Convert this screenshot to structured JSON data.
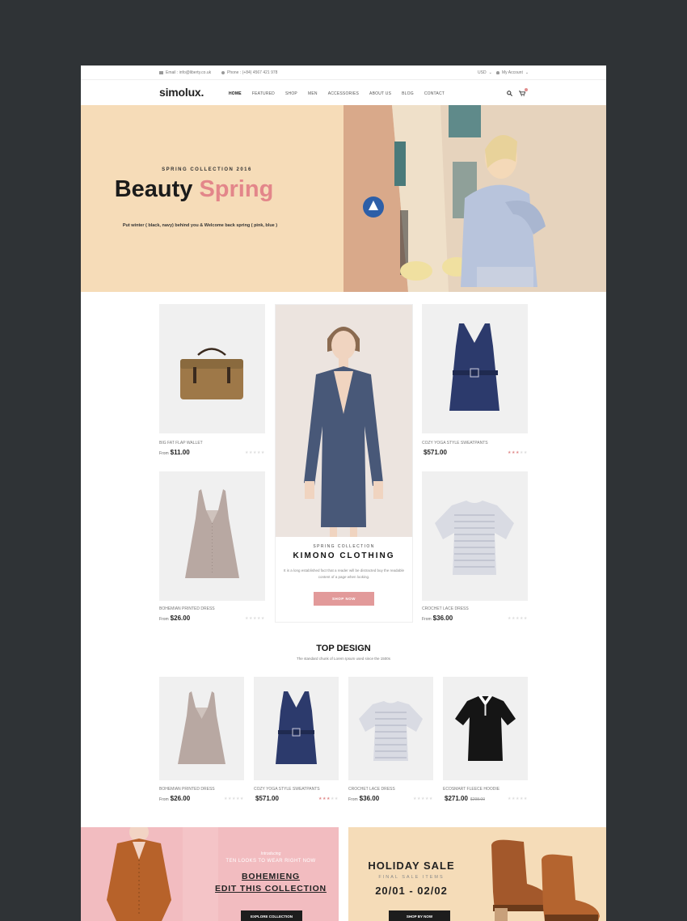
{
  "topbar": {
    "email": "Email : info@liberty.co.uk",
    "phone": "Phone : (+84) 4567 421 978",
    "currency": "USD",
    "currency_caret": "⌄",
    "account": "My Account",
    "account_caret": "⌄"
  },
  "header": {
    "logo": "simolux.",
    "nav": [
      "HOME",
      "FEATURED",
      "SHOP",
      "MEN",
      "ACCESSORIES",
      "ABOUT US",
      "BLOG",
      "CONTACT"
    ],
    "active_nav": "HOME",
    "search_icon": "⚲",
    "cart_icon": "🛒"
  },
  "hero": {
    "subtitle": "SPRING COLLECTION 2016",
    "title_main": "Beauty",
    "title_accent": "Spring",
    "description": "Put winter ( black, navy) behind you & Welcome back spring ( pink, blue )"
  },
  "grid_products": [
    {
      "name": "BIG FAT FLAP WALLET",
      "from": "From",
      "price": "$11.00",
      "rating": 0
    },
    {
      "name": "COZY YOGA STYLE SWEATPANTS",
      "from": "",
      "price": "$571.00",
      "rating": 3
    },
    {
      "name": "BOHEMIAN PRINTED DRESS",
      "from": "From",
      "price": "$26.00",
      "rating": 0
    },
    {
      "name": "CROCHET LACE DRESS",
      "from": "From",
      "price": "$36.00",
      "rating": 0
    }
  ],
  "feature": {
    "subtitle": "SPRING COLLECTION",
    "title": "KIMONO CLOTHING",
    "description": "It is a long established fact that a reader will be distracted buy the readable content of a page when looking.",
    "button": "SHOP NOW"
  },
  "top_design": {
    "title": "TOP DESIGN",
    "subtitle": "The standard chunk of Lorem Ipsum used since the 1500s",
    "products": [
      {
        "name": "BOHEMIAN PRINTED DRESS",
        "from": "From",
        "price": "$26.00",
        "old_price": "",
        "rating": 0
      },
      {
        "name": "COZY YOGA STYLE SWEATPANTS",
        "from": "",
        "price": "$571.00",
        "old_price": "",
        "rating": 3
      },
      {
        "name": "CROCHET LACE DRESS",
        "from": "From",
        "price": "$36.00",
        "old_price": "",
        "rating": 0
      },
      {
        "name": "ECOSMART FLEECE HOODIE",
        "from": "",
        "price": "$271.00",
        "old_price": "$298.00",
        "rating": 0
      }
    ]
  },
  "banner_left": {
    "intro": "Introducing",
    "line1": "TEN LOOKS TO WEAR RIGHT NOW",
    "line2": "BOHEMIENG",
    "line3": "EDIT THIS COLLECTION",
    "button": "EXPLORE COLLECTION"
  },
  "banner_right": {
    "title": "HOLIDAY SALE",
    "subtitle": "FINAL SALE ITEMS",
    "dates": "20/01 - 02/02",
    "button": "SHOP BY NOW"
  },
  "colors": {
    "accent": "#e3868a",
    "hero_bg": "#f6dcb8",
    "banner_pink": "#f2bcc0",
    "banner_peach": "#f5dcb8",
    "outer_bg": "#2f3336"
  }
}
